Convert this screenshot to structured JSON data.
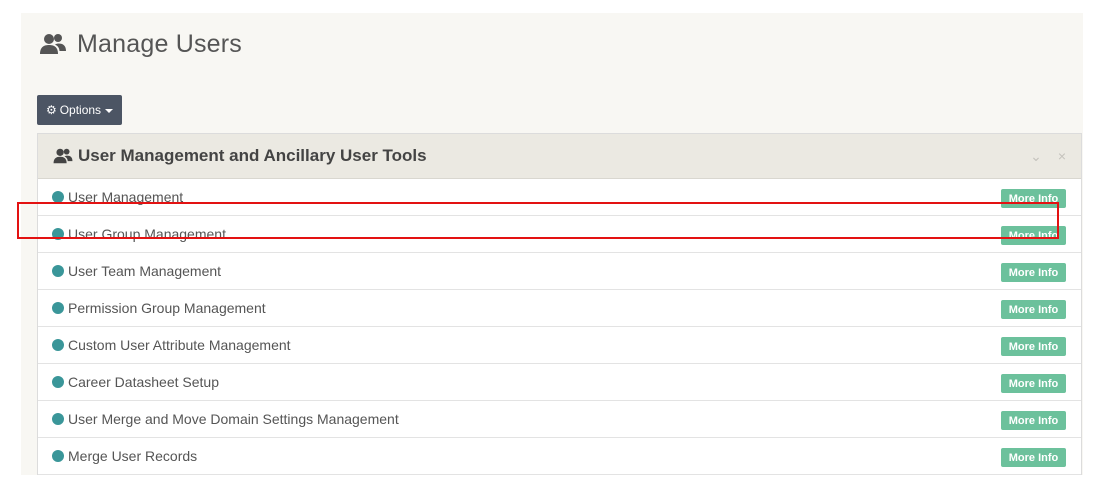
{
  "header": {
    "title": "Manage Users",
    "icon": "users-icon"
  },
  "options_button": {
    "label": "Options",
    "icon": "gear-icon"
  },
  "panel": {
    "title": "User Management and Ancillary User Tools",
    "icon": "users-icon",
    "tools": [
      "collapse-chevron-icon",
      "close-icon"
    ],
    "items": [
      {
        "label": "User Management",
        "action": "More Info"
      },
      {
        "label": "User Group Management",
        "action": "More Info",
        "highlighted": true
      },
      {
        "label": "User Team Management",
        "action": "More Info"
      },
      {
        "label": "Permission Group Management",
        "action": "More Info"
      },
      {
        "label": "Custom User Attribute Management",
        "action": "More Info"
      },
      {
        "label": "Career Datasheet Setup",
        "action": "More Info"
      },
      {
        "label": "User Merge and Move Domain Settings Management",
        "action": "More Info"
      },
      {
        "label": "Merge User Records",
        "action": "More Info"
      }
    ]
  },
  "colors": {
    "page_bg": "#f8f7f3",
    "button_bg": "#4c5564",
    "panel_header_bg": "#ebe9e2",
    "bullet": "#3a9699",
    "badge": "#6cc19c",
    "highlight": "#e31212"
  }
}
